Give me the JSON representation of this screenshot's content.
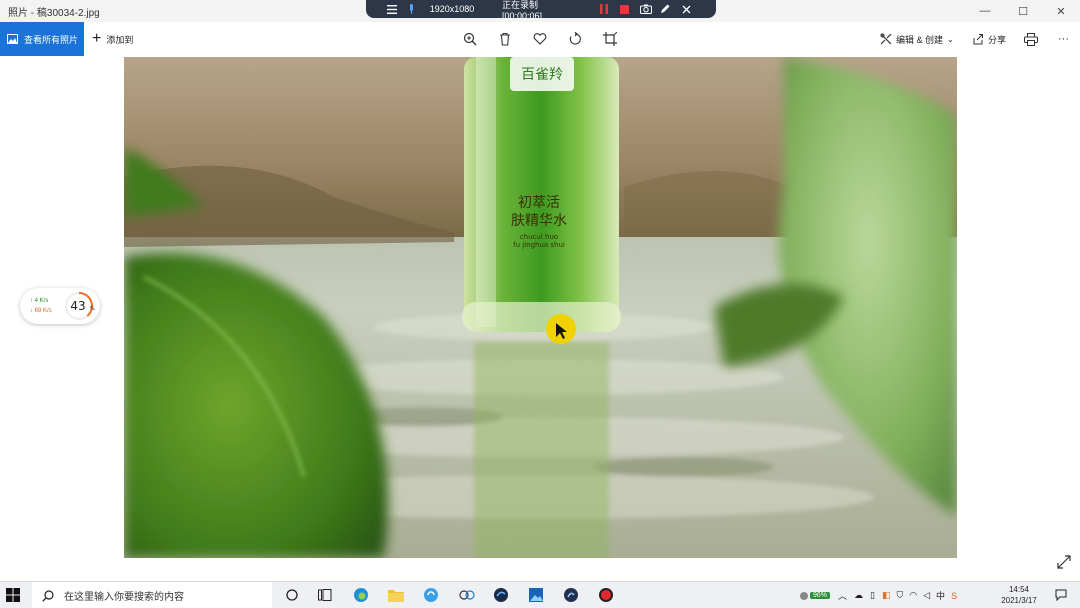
{
  "window": {
    "title": "照片 - 稿30034-2.jpg",
    "controls": [
      "—",
      "☐",
      "✕"
    ]
  },
  "recorder": {
    "resolution": "1920x1080",
    "status": "正在录制 [00:00:06]"
  },
  "commandbar": {
    "view_all_label": "查看所有照片",
    "add_to_label": "添加到",
    "edit_create_label": "编辑 & 创建",
    "share_label": "分享",
    "more_label": "···"
  },
  "photo": {
    "bottle_brand": "百雀羚",
    "bottle_line1": "初萃活",
    "bottle_line2": "肤精华水",
    "bottle_pinyin1": "chucui huo",
    "bottle_pinyin2": "fu jinghua shui"
  },
  "zoom_widget": {
    "up_speed": "↑ 4  K/s",
    "down_speed": "↓ 69  K/s",
    "percent": "43",
    "percent_unit": "%"
  },
  "taskbar": {
    "search_placeholder": "在这里输入你要搜索的内容",
    "battery": "96%",
    "ime": "中",
    "time": "14:54",
    "date": "2021/3/17"
  },
  "colors": {
    "accent": "#1a73d9",
    "recbar": "#2e3748",
    "rec_red": "#e03a3a"
  }
}
